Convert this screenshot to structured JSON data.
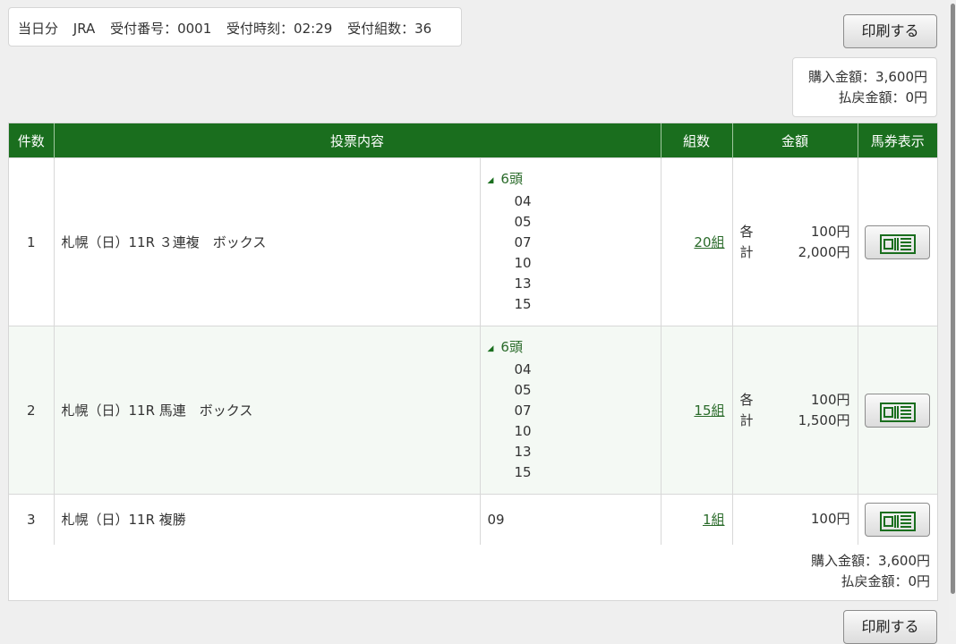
{
  "header": {
    "day": "当日分",
    "org": "JRA",
    "receipt_no": "受付番号：0001",
    "receipt_time": "受付時刻：02:29",
    "receipt_count": "受付組数：36"
  },
  "print_label": "印刷する",
  "totals": {
    "purchase": "購入金額：3,600円",
    "refund": "払戻金額：0円"
  },
  "table": {
    "headers": [
      "件数",
      "投票内容",
      "組数",
      "金額",
      "馬券表示"
    ],
    "rows": [
      {
        "index": "1",
        "content": "札幌（日）11R ３連複　ボックス",
        "horse_head": "6頭",
        "horses": [
          "04",
          "05",
          "07",
          "10",
          "13",
          "15"
        ],
        "combos": "20組",
        "each_label": "各",
        "each_value": "100円",
        "total_label": "計",
        "total_value": "2,000円"
      },
      {
        "index": "2",
        "content": "札幌（日）11R 馬連　ボックス",
        "horse_head": "6頭",
        "horses": [
          "04",
          "05",
          "07",
          "10",
          "13",
          "15"
        ],
        "combos": "15組",
        "each_label": "各",
        "each_value": "100円",
        "total_label": "計",
        "total_value": "1,500円"
      },
      {
        "index": "3",
        "content": "札幌（日）11R 複勝",
        "horse": "09",
        "combos": "1組",
        "amount": "100円"
      }
    ]
  },
  "colors": {
    "header_green": "#1a6e1e",
    "link_green": "#2a6b2a",
    "alt_row": "#f4f9f4"
  },
  "icons": {
    "ticket": "ticket-icon",
    "expand": "triangle-expanded-icon"
  }
}
